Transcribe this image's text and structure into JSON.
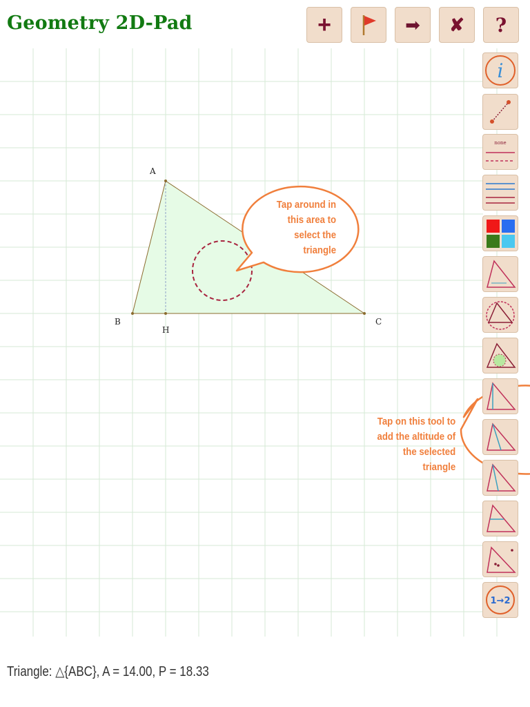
{
  "app": {
    "title": "Geometry 2D-Pad"
  },
  "toolbar": {
    "add_label": "+",
    "flag_label": "flag",
    "arrow_label": "➡",
    "close_label": "✘",
    "help_label": "?"
  },
  "sidebar": {
    "info_label": "i",
    "line_style_label": "none",
    "number_tool_label": "1→2"
  },
  "points": {
    "a": "A",
    "b": "B",
    "c": "C",
    "h": "H"
  },
  "callouts": {
    "select_triangle": [
      "Tap around in",
      "this area  to",
      "select the",
      "triangle"
    ],
    "altitude_tool": [
      "Tap on this tool to",
      "add the altitude of",
      "the selected",
      "triangle"
    ]
  },
  "status": {
    "text": "Triangle: △{ABC}, A = 14.00, P = 18.33"
  },
  "colors": {
    "title_green": "#127a12",
    "button_bg": "#f1ddcb",
    "callout_orange": "#f07f3c",
    "triangle_fill": "#e6fbe6",
    "grid": "#d6ead6",
    "icon_maroon": "#8a1e36"
  }
}
